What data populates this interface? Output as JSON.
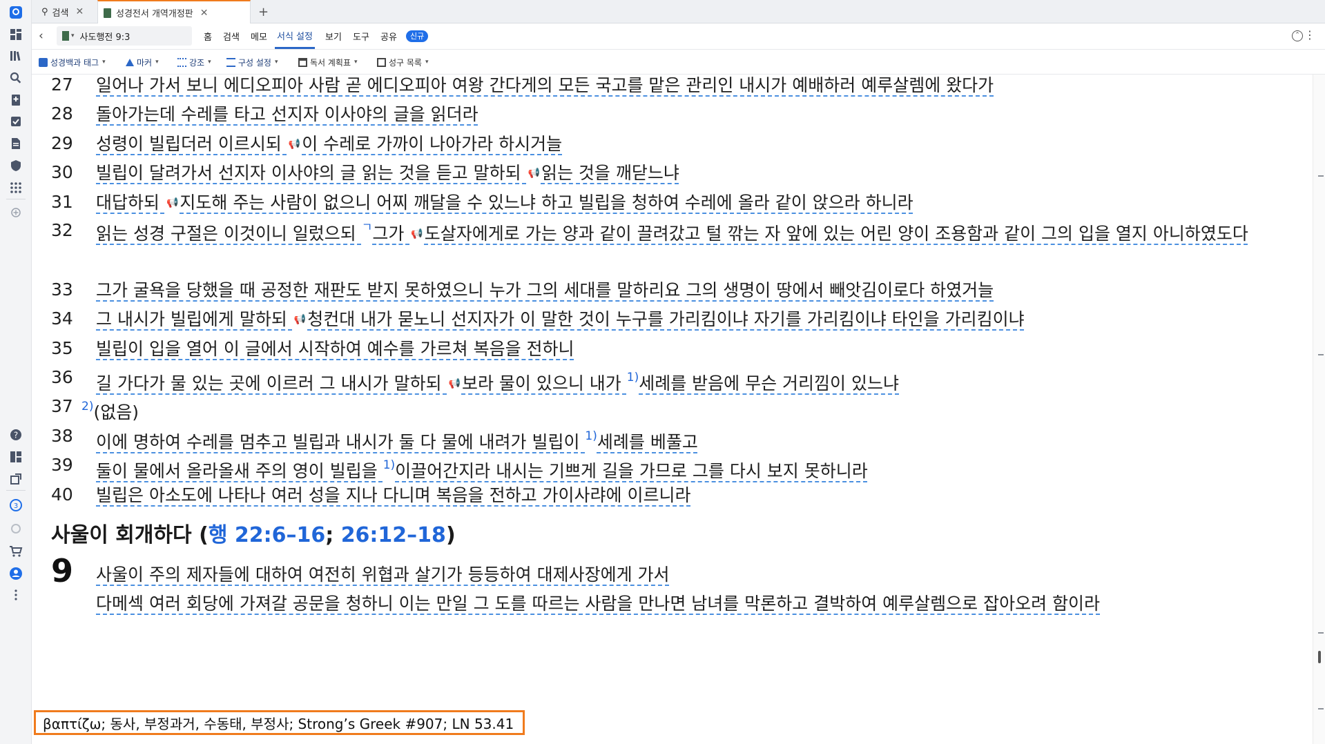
{
  "tabs": [
    {
      "label": "검색",
      "icon": "search-icon"
    },
    {
      "label": "성경전서 개역개정판",
      "icon": "book-icon"
    }
  ],
  "toolbar": {
    "reference": "사도행전 9:3",
    "menus": [
      "홈",
      "검색",
      "메모",
      "서식 설정",
      "보기",
      "도구",
      "공유"
    ],
    "new_badge": "신규"
  },
  "subtoolbar": [
    "성경백과 태그",
    "마커",
    "강조",
    "구성 설정",
    "독서 계획표",
    "성구 목록"
  ],
  "verses": [
    {
      "n": "27",
      "text": "일어나 가서 보니 에디오피아 사람 곧 에디오피아 여왕 간다게의 모든 국고를 맡은 관리인 내시가 예배하러 예루살렘에 왔다가"
    },
    {
      "n": "28",
      "text": "돌아가는데 수레를 타고 선지자 이사야의 글을 읽더라"
    },
    {
      "n": "29",
      "a": "성령이 빌립더러 이르시되 ",
      "b": "이 수레로 가까이 나아가라 하시거늘"
    },
    {
      "n": "30",
      "a": "빌립이 달려가서 선지자 이사야의 글 읽는 것을 듣고 말하되 ",
      "b": "읽는 것을 깨닫느냐"
    },
    {
      "n": "31",
      "a": "대답하되 ",
      "b": "지도해 주는 사람이 없으니 어찌 깨달을 수 있느냐 하고 빌립을 청하여 수레에 올라 같이 앉으라 하니라"
    },
    {
      "n": "32",
      "a": "읽는 성경 구절은 이것이니 일렀으되 ",
      "mark": "ㄱ",
      "b": "그가 ",
      "c": "도살자에게로 가는 양과 같이 끌려갔고 털 깎는 자 앞에 있는 어린 양이 조용함과 같이 그의 입을 열지 아니하였도다"
    },
    {
      "n": "33",
      "text": "그가 굴욕을 당했을 때 공정한 재판도 받지 못하였으니 누가 그의 세대를 말하리요 그의 생명이 땅에서 빼앗김이로다 하였거늘"
    },
    {
      "n": "34",
      "a": "그 내시가 빌립에게 말하되 ",
      "b": "청컨대 내가 묻노니 선지자가 이 말한 것이 누구를 가리킴이냐 자기를 가리킴이냐 타인을 가리킴이냐"
    },
    {
      "n": "35",
      "text": "빌립이 입을 열어 이 글에서 시작하여 예수를 가르쳐 복음을 전하니"
    },
    {
      "n": "36",
      "a": "길 가다가 물 있는 곳에 이르러 그 내시가 말하되 ",
      "b": "보라 물이 있으니 내가 ",
      "fn": "1)",
      "c": "세례를 받음에 무슨 거리낌이 있느냐"
    },
    {
      "n": "37",
      "fn": "2)",
      "text": "(없음)"
    },
    {
      "n": "38",
      "a": "이에 명하여 수레를 멈추고 빌립과 내시가 둘 다 물에 내려가 빌립이 ",
      "fn": "1)",
      "b": "세례를 베풀고"
    },
    {
      "n": "39",
      "a": "둘이 물에서 올라올새 주의 영이 빌립을 ",
      "fn": "1)",
      "b": "이끌어간지라 내시는 기쁘게 길을 가므로 그를 다시 보지 못하니라"
    },
    {
      "n": "40",
      "text": "빌립은 아소도에 나타나 여러 성을 지나 다니며 복음을 전하고 가이사랴에 이르니라"
    }
  ],
  "heading": {
    "title": "사울이 회개하다 (",
    "ref1": "행 22:6–16",
    "sep": "; ",
    "ref2": "26:12–18",
    "close": ")"
  },
  "chapter": {
    "number": "9",
    "verse1": "사울이 주의 제자들에 대하여 여전히 위협과 살기가 등등하여 대제사장에게 가서",
    "verse2_partial": "다메섹 여러 회당에 가져갈 공문을 청하니 이는 만일 그 도를 따르는 사람을 만나면 남녀를 막론하고 결박하여 예루살렘으로 잡아오려 함이라"
  },
  "speaker_glyph": "📢",
  "status_text": "βαπτίζω; 동사, 부정과거, 수동태, 부정사; Strong’s Greek #907; LN 53.41",
  "colors": {
    "accent": "#f07b1d",
    "link": "#2066d8",
    "underline": "#4a8fe0"
  }
}
